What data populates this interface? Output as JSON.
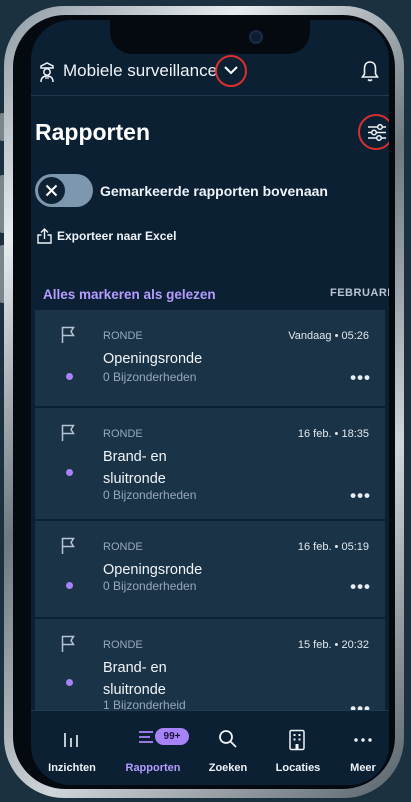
{
  "header": {
    "title": "Mobiele surveillance"
  },
  "page": {
    "title": "Rapporten",
    "toggle_label": "Gemarkeerde rapporten bovenaan",
    "export_label": "Exporteer naar Excel",
    "mark_all_label": "Alles markeren als gelezen",
    "month_label": "FEBRUARI"
  },
  "reports": [
    {
      "type": "RONDE",
      "date": "Vandaag • 05:26",
      "name": "Openingsronde",
      "details": "0 Bijzonderheden"
    },
    {
      "type": "RONDE",
      "date": "16 feb. • 18:35",
      "name": "Brand- en sluitronde",
      "details": "0 Bijzonderheden"
    },
    {
      "type": "RONDE",
      "date": "16 feb. • 05:19",
      "name": "Openingsronde",
      "details": "0 Bijzonderheden"
    },
    {
      "type": "RONDE",
      "date": "15 feb. • 20:32",
      "name": "Brand- en sluitronde",
      "details": "1 Bijzonderheid"
    }
  ],
  "tabbar": {
    "items": [
      {
        "label": "Inzichten",
        "icon": "bar-chart-icon"
      },
      {
        "label": "Rapporten",
        "icon": "list-icon",
        "badge": "99+",
        "active": true
      },
      {
        "label": "Zoeken",
        "icon": "search-icon"
      },
      {
        "label": "Locaties",
        "icon": "building-icon"
      },
      {
        "label": "Meer",
        "icon": "more-icon"
      }
    ]
  },
  "colors": {
    "background": "#0c2033",
    "card": "#1a3347",
    "accent": "#a883f7",
    "highlight_ring": "#d9302e"
  }
}
